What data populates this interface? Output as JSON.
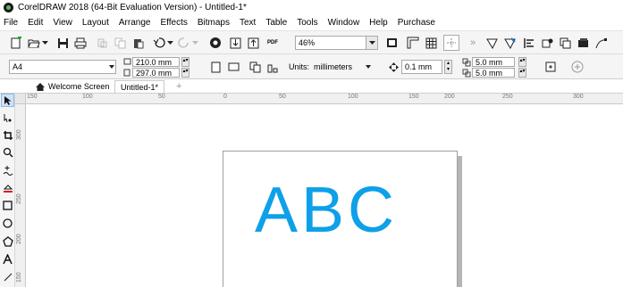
{
  "window": {
    "title": "CorelDRAW 2018 (64-Bit Evaluation Version) - Untitled-1*"
  },
  "menu": [
    "File",
    "Edit",
    "View",
    "Layout",
    "Arrange",
    "Effects",
    "Bitmaps",
    "Text",
    "Table",
    "Tools",
    "Window",
    "Help",
    "Purchase"
  ],
  "toolbar1": {
    "zoom_value": "46%",
    "pdf_label": "PDF"
  },
  "toolbar2": {
    "page_size": "A4",
    "width_value": "210.0 mm",
    "height_value": "297.0 mm",
    "units_label": "Units:",
    "units_value": "millimeters",
    "nudge_value": "0.1 mm",
    "dup_x_value": "5.0 mm",
    "dup_y_value": "5.0 mm"
  },
  "tabs": {
    "welcome": "Welcome Screen",
    "document": "Untitled-1*",
    "add": "+"
  },
  "ruler": {
    "h_labels": [
      "150",
      "100",
      "50",
      "0",
      "50",
      "100",
      "150",
      "200",
      "250",
      "300"
    ],
    "v_labels": [
      "300",
      "250",
      "200",
      "150"
    ]
  },
  "document": {
    "text": "ABC",
    "text_color": "#0ea0e8"
  }
}
